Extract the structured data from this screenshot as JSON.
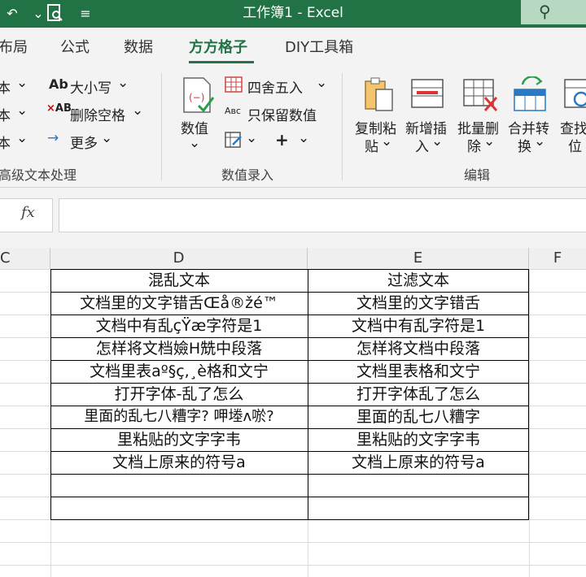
{
  "window": {
    "title": "工作簿1  -  Excel"
  },
  "tabs": [
    "布局",
    "公式",
    "数据",
    "方方格子",
    "DIY工具箱"
  ],
  "active_tab": "方方格子",
  "ribbon": {
    "left_partial": [
      "本",
      "本",
      "本"
    ],
    "text_group": {
      "case_label": "大小写",
      "remove_space_label": "删除空格",
      "more_label": "更多",
      "group_label": "高级文本处理"
    },
    "number_group": {
      "value_label": "数值",
      "round_label": "四舍五入",
      "keep_value_label": "只保留数值",
      "group_label": "数值录入"
    },
    "edit_group": {
      "copy_paste": [
        "复制粘",
        "贴"
      ],
      "insert_new": [
        "新增插",
        "入"
      ],
      "batch_delete": [
        "批量删",
        "除"
      ],
      "merge_convert": [
        "合并转",
        "换"
      ],
      "find_locate": [
        "查找",
        "位"
      ],
      "group_label": "编辑"
    }
  },
  "formula_bar": {
    "fx": "fx",
    "value": ""
  },
  "columns": [
    "C",
    "D",
    "E",
    "F"
  ],
  "table": {
    "headers": [
      "混乱文本",
      "过滤文本"
    ],
    "rows": [
      [
        "文档里的文字错舌Œå®žé™",
        "文档里的文字错舌"
      ],
      [
        "文档中有乱çŸæ字符是1",
        "文档中有乱字符是1"
      ],
      [
        "怎样将文档嬐H兟中段落",
        "怎样将文档中段落"
      ],
      [
        "文档里表aº§ç,¸è格和文宁",
        "文档里表格和文宁"
      ],
      [
        "打开字体-乱了怎么",
        "打开字体乱了怎么"
      ],
      [
        "里面的乱七八糟字?  呷堘ʌ唹?",
        "里面的乱七八糟字"
      ],
      [
        "里粘贴的文字字韦",
        "里粘贴的文字字韦"
      ],
      [
        "文档上原来的符号a",
        "文档上原来的符号a"
      ],
      [
        "",
        ""
      ],
      [
        "",
        ""
      ]
    ]
  }
}
